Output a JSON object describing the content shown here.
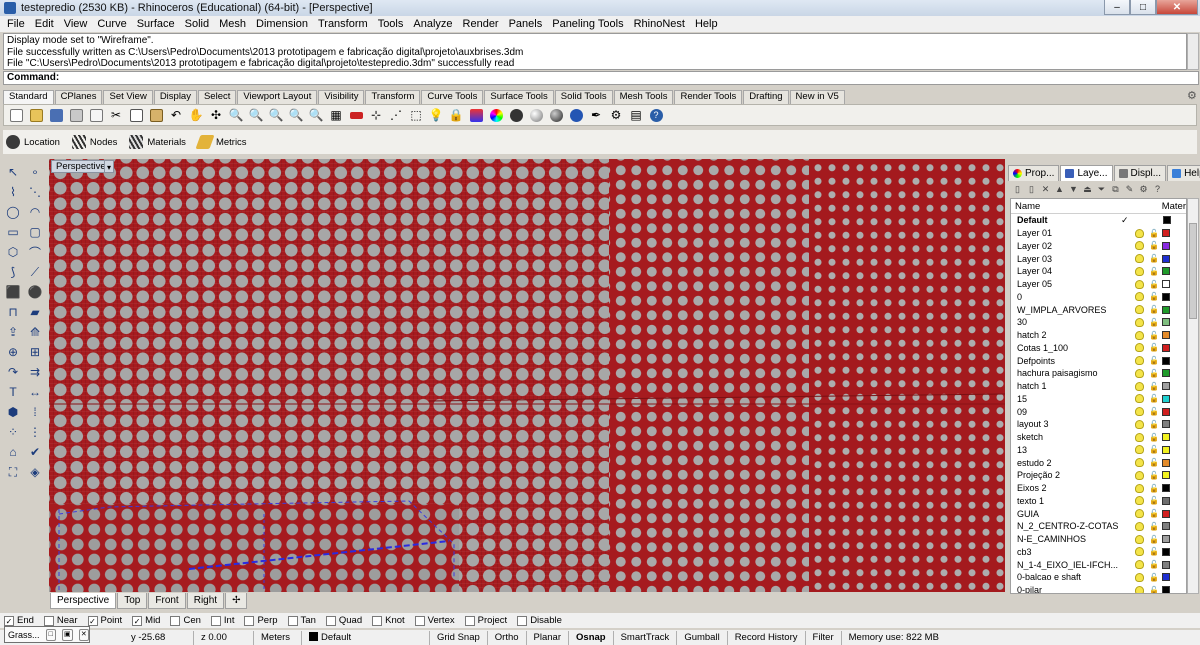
{
  "window": {
    "title": "testepredio (2530 KB) - Rhinoceros (Educational) (64-bit) - [Perspective]",
    "minimize": "–",
    "maximize": "□",
    "close": "✕"
  },
  "menu": [
    "File",
    "Edit",
    "View",
    "Curve",
    "Surface",
    "Solid",
    "Mesh",
    "Dimension",
    "Transform",
    "Tools",
    "Analyze",
    "Render",
    "Panels",
    "Paneling Tools",
    "RhinoNest",
    "Help"
  ],
  "command_history": [
    "Display mode set to \"Wireframe\".",
    "File successfully written as C:\\Users\\Pedro\\Documents\\2013 prototipagem e fabricação digital\\projeto\\auxbrises.3dm",
    "File \"C:\\Users\\Pedro\\Documents\\2013 prototipagem e fabricação digital\\projeto\\testepredio.3dm\" successfully read"
  ],
  "command_prompt": "Command:",
  "toolbar_tabs": [
    "Standard",
    "CPlanes",
    "Set View",
    "Display",
    "Select",
    "Viewport Layout",
    "Visibility",
    "Transform",
    "Curve Tools",
    "Surface Tools",
    "Solid Tools",
    "Mesh Tools",
    "Render Tools",
    "Drafting",
    "New in V5"
  ],
  "plugin_toolbar": [
    "Location",
    "Nodes",
    "Materials",
    "Metrics"
  ],
  "viewport": {
    "active_title": "Perspective",
    "tabs": [
      "Perspective",
      "Top",
      "Front",
      "Right"
    ],
    "add_tab": "✢"
  },
  "right_panel": {
    "tabs": [
      "Prop...",
      "Laye...",
      "Displ...",
      "Help"
    ],
    "columns": {
      "name": "Name",
      "material": "Mater"
    },
    "layers": [
      {
        "name": "Default",
        "color": "#000000",
        "current": "✓"
      },
      {
        "name": "Layer 01",
        "color": "#d11f1f"
      },
      {
        "name": "Layer 02",
        "color": "#8a2be2"
      },
      {
        "name": "Layer 03",
        "color": "#1f2fd1"
      },
      {
        "name": "Layer 04",
        "color": "#1f9b2a"
      },
      {
        "name": "Layer 05",
        "color": "#ffffff"
      },
      {
        "name": "0",
        "color": "#000000"
      },
      {
        "name": "W_IMPLA_ARVORES",
        "color": "#1f9b2a"
      },
      {
        "name": "30",
        "color": "#7fbf7f"
      },
      {
        "name": "hatch 2",
        "color": "#e38b2a"
      },
      {
        "name": "Cotas 1_100",
        "color": "#d11f1f"
      },
      {
        "name": "Defpoints",
        "color": "#000000"
      },
      {
        "name": "hachura paisagismo",
        "color": "#1f9b2a"
      },
      {
        "name": "hatch 1",
        "color": "#a0a0a0"
      },
      {
        "name": "15",
        "color": "#1fd1d1"
      },
      {
        "name": "09",
        "color": "#d11f1f"
      },
      {
        "name": "layout 3",
        "color": "#808080"
      },
      {
        "name": "sketch",
        "color": "#f2f21f"
      },
      {
        "name": "13",
        "color": "#f2f21f"
      },
      {
        "name": "estudo 2",
        "color": "#e38b2a"
      },
      {
        "name": "Projeção 2",
        "color": "#f2f21f"
      },
      {
        "name": "Eixos 2",
        "color": "#000000"
      },
      {
        "name": "texto 1",
        "color": "#6e6e6e"
      },
      {
        "name": "GUIA",
        "color": "#d11f1f"
      },
      {
        "name": "N_2_CENTRO-Z-COTAS",
        "color": "#808080"
      },
      {
        "name": "N-E_CAMINHOS",
        "color": "#a0a0a0"
      },
      {
        "name": "cb3",
        "color": "#000000"
      },
      {
        "name": "N_1-4_EIXO_IEL-IFCH...",
        "color": "#808080"
      },
      {
        "name": "0-balcao e shaft",
        "color": "#1f2fd1"
      },
      {
        "name": "0-pilar",
        "color": "#000000"
      }
    ]
  },
  "osnaps": [
    {
      "label": "End",
      "checked": true
    },
    {
      "label": "Near",
      "checked": false
    },
    {
      "label": "Point",
      "checked": true
    },
    {
      "label": "Mid",
      "checked": true
    },
    {
      "label": "Cen",
      "checked": false
    },
    {
      "label": "Int",
      "checked": false
    },
    {
      "label": "Perp",
      "checked": false
    },
    {
      "label": "Tan",
      "checked": false
    },
    {
      "label": "Quad",
      "checked": false
    },
    {
      "label": "Knot",
      "checked": false
    },
    {
      "label": "Vertex",
      "checked": false
    },
    {
      "label": "Project",
      "checked": false
    },
    {
      "label": "Disable",
      "checked": false
    }
  ],
  "status": {
    "y": "y -25.68",
    "z": "z 0.00",
    "units": "Meters",
    "layer": "Default",
    "grid_snap": "Grid Snap",
    "ortho": "Ortho",
    "planar": "Planar",
    "osnap": "Osnap",
    "smarttrack": "SmartTrack",
    "gumball": "Gumball",
    "record_history": "Record History",
    "filter": "Filter",
    "memory": "Memory use: 822 MB"
  },
  "grasshopper": {
    "label": "Grass..."
  }
}
